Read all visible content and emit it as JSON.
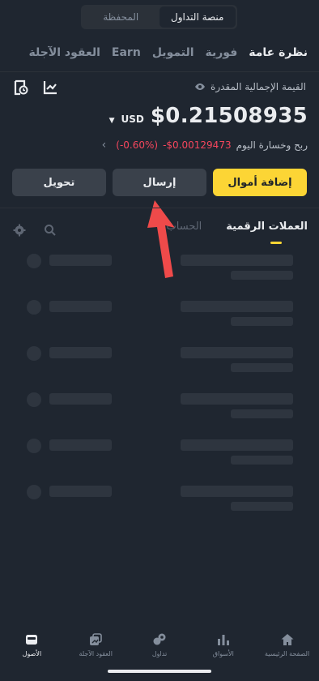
{
  "top_switch": {
    "exchange": "منصة التداول",
    "wallet": "المحفظة"
  },
  "tabs": [
    "نظرة عامة",
    "فورية",
    "التمويل",
    "Earn",
    "العقود الآجلة"
  ],
  "balance": {
    "label": "القيمة الإجمالية المقدرة",
    "amount": "$0.21508935",
    "currency": "USD",
    "pnl_label": "ربح وخسارة اليوم",
    "pnl_value": "-$0.00129473",
    "pnl_pct": "(-0.60%)"
  },
  "actions": {
    "deposit": "إضافة أموال",
    "send": "إرسال",
    "transfer": "تحويل"
  },
  "subtabs": {
    "crypto": "العملات الرقمية",
    "account": "الحساب"
  },
  "nav": {
    "home": "الصفحة الرئيسية",
    "markets": "الأسواق",
    "trade": "تداول",
    "futures": "العقود الآجلة",
    "assets": "الأصول"
  },
  "icons": {
    "eye": "eye-icon",
    "history": "history-icon",
    "chart": "chart-icon",
    "search": "search-icon",
    "settings": "gear-icon",
    "back": "chevron-left-icon"
  },
  "colors": {
    "accent": "#fcd535",
    "negative": "#f6465d",
    "bg": "#1f2630"
  }
}
